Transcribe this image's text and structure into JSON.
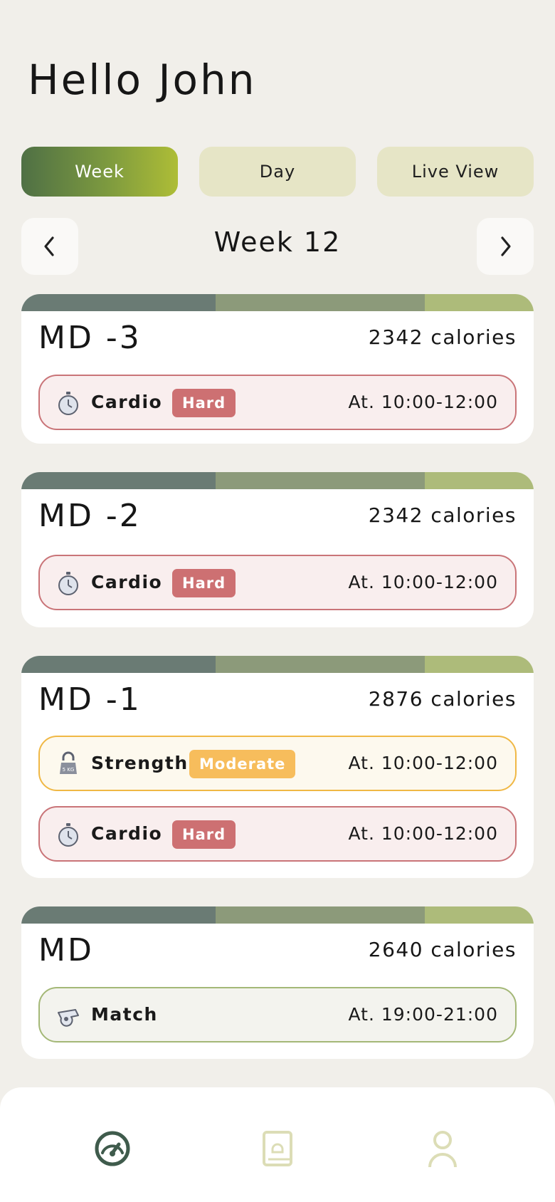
{
  "greeting": "Hello John",
  "view_tabs": [
    {
      "label": "Week",
      "active": true
    },
    {
      "label": "Day",
      "active": false
    },
    {
      "label": "Live View",
      "active": false
    }
  ],
  "week_nav": {
    "label": "Week 12",
    "prev_icon": "chevron-left-icon",
    "next_icon": "chevron-right-icon"
  },
  "days": [
    {
      "title": "MD -3",
      "calories": "2342 calories",
      "sessions": [
        {
          "icon": "stopwatch-icon",
          "name": "Cardio",
          "badge": "Hard",
          "time": "At. 10:00-12:00"
        }
      ]
    },
    {
      "title": "MD -2",
      "calories": "2342 calories",
      "sessions": [
        {
          "icon": "stopwatch-icon",
          "name": "Cardio",
          "badge": "Hard",
          "time": "At. 10:00-12:00"
        }
      ]
    },
    {
      "title": "MD -1",
      "calories": "2876 calories",
      "sessions": [
        {
          "icon": "kettlebell-icon",
          "name": "Strength",
          "badge": "Moderate",
          "time": "At. 10:00-12:00",
          "icon_text": "5 KG"
        },
        {
          "icon": "stopwatch-icon",
          "name": "Cardio",
          "badge": "Hard",
          "time": "At. 10:00-12:00"
        }
      ]
    },
    {
      "title": "MD",
      "calories": "2640 calories",
      "sessions": [
        {
          "icon": "whistle-icon",
          "name": "Match",
          "time": "At. 19:00-21:00"
        }
      ]
    }
  ],
  "colors": {
    "background": "#f1efea",
    "accent_gradient_start": "#4f7045",
    "accent_gradient_end": "#aebd36",
    "hard": "#cd7072",
    "moderate": "#f7bd5c",
    "match_border": "#a4b877"
  },
  "bottom_nav": [
    {
      "icon": "dashboard-gauge-icon",
      "active": true
    },
    {
      "icon": "recipe-book-icon",
      "active": false
    },
    {
      "icon": "profile-icon",
      "active": false
    }
  ]
}
